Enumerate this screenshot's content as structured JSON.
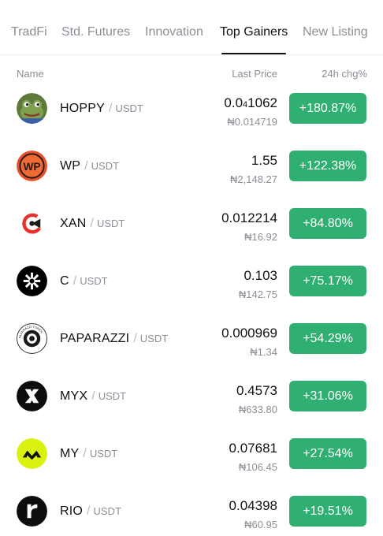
{
  "tabs": [
    {
      "label": "TradFi",
      "active": false
    },
    {
      "label": "Std. Futures",
      "active": false
    },
    {
      "label": "Innovation",
      "active": false
    },
    {
      "label": "Top Gainers",
      "active": true
    },
    {
      "label": "New Listing",
      "active": false
    }
  ],
  "columns": {
    "name": "Name",
    "last_price": "Last Price",
    "change": "24h chg%"
  },
  "colors": {
    "gain": "#2fb072",
    "muted": "#8b8f96",
    "text": "#121212"
  },
  "rows": [
    {
      "base": "HOPPY",
      "sep": "/",
      "quote": "USDT",
      "price_pre": "0.0",
      "price_sub": "4",
      "price_post": "1062",
      "fiat": "₦0.014719",
      "change": "+180.87%",
      "icon": "frog-avatar-icon"
    },
    {
      "base": "WP",
      "sep": "/",
      "quote": "USDT",
      "price_pre": "1.55",
      "price_sub": "",
      "price_post": "",
      "fiat": "₦2,148.27",
      "change": "+122.38%",
      "icon": "wp-logo-icon",
      "icon_text": "WP"
    },
    {
      "base": "XAN",
      "sep": "/",
      "quote": "USDT",
      "price_pre": "0.012214",
      "price_sub": "",
      "price_post": "",
      "fiat": "₦16.92",
      "change": "+84.80%",
      "icon": "xan-logo-icon"
    },
    {
      "base": "C",
      "sep": "/",
      "quote": "USDT",
      "price_pre": "0.103",
      "price_sub": "",
      "price_post": "",
      "fiat": "₦142.75",
      "change": "+75.17%",
      "icon": "c-logo-icon"
    },
    {
      "base": "PAPARAZZI",
      "sep": "/",
      "quote": "USDT",
      "price_pre": "0.000969",
      "price_sub": "",
      "price_post": "",
      "fiat": "₦1.34",
      "change": "+54.29%",
      "icon": "camera-seal-icon",
      "icon_text": "PAPARAZZI TOKEN"
    },
    {
      "base": "MYX",
      "sep": "/",
      "quote": "USDT",
      "price_pre": "0.4573",
      "price_sub": "",
      "price_post": "",
      "fiat": "₦633.80",
      "change": "+31.06%",
      "icon": "myx-logo-icon"
    },
    {
      "base": "MY",
      "sep": "/",
      "quote": "USDT",
      "price_pre": "0.07681",
      "price_sub": "",
      "price_post": "",
      "fiat": "₦106.45",
      "change": "+27.54%",
      "icon": "my-logo-icon"
    },
    {
      "base": "RIO",
      "sep": "/",
      "quote": "USDT",
      "price_pre": "0.04398",
      "price_sub": "",
      "price_post": "",
      "fiat": "₦60.95",
      "change": "+19.51%",
      "icon": "rio-logo-icon"
    }
  ]
}
